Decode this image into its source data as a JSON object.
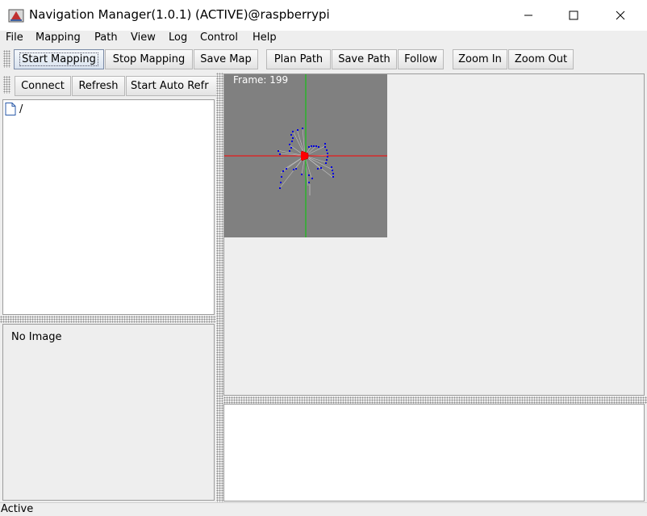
{
  "window": {
    "title": "Navigation Manager(1.0.1) (ACTIVE)@raspberrypi",
    "icons": [
      "java-app-icon",
      "minimize-icon",
      "maximize-icon",
      "close-icon"
    ]
  },
  "menu": [
    "File",
    "Mapping",
    "Path",
    "View",
    "Log",
    "Control",
    "Help"
  ],
  "toolbar": {
    "group1": [
      "Start Mapping",
      "Stop Mapping",
      "Save Map"
    ],
    "group2": [
      "Plan Path",
      "Save Path",
      "Follow"
    ],
    "group3": [
      "Zoom In",
      "Zoom Out"
    ]
  },
  "left_toolbar": [
    "Connect",
    "Refresh",
    "Start Auto Refr"
  ],
  "tree": {
    "root_label": "/",
    "icon": "file-icon"
  },
  "image_panel": {
    "text": "No Image"
  },
  "map": {
    "frame_label": "Frame: 199",
    "background": "#808080",
    "x_axis_color": "#ff0000",
    "y_axis_color": "#00cc00",
    "scan_point_color": "#0000dd",
    "robot_color": "#ff0000"
  },
  "status": {
    "text": "Active"
  }
}
